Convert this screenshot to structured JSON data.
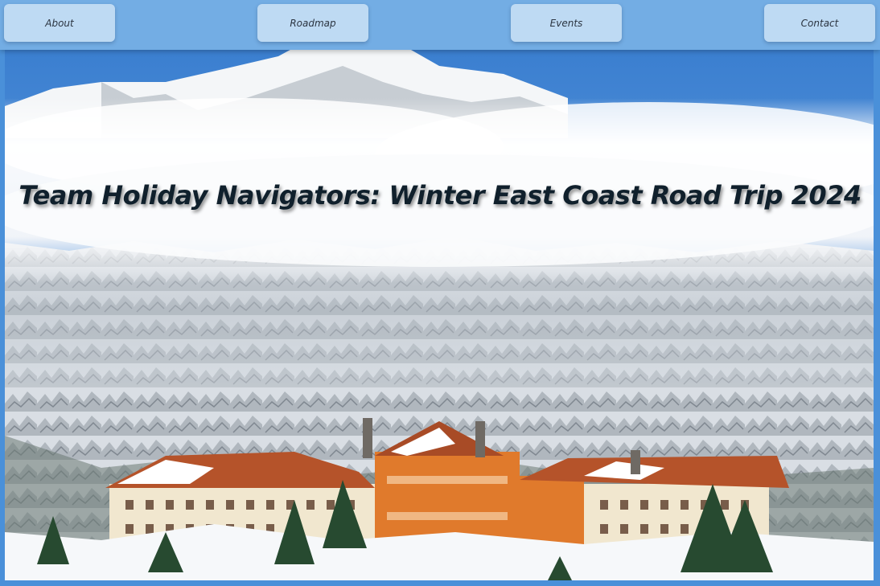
{
  "nav": {
    "items": [
      {
        "label": "About"
      },
      {
        "label": "Roadmap"
      },
      {
        "label": "Events"
      },
      {
        "label": "Contact"
      }
    ]
  },
  "hero": {
    "title": "Team Holiday Navigators: Winter East Coast Road Trip 2024"
  },
  "colors": {
    "background": "#4a90d9",
    "nav_bar": "#96c4ec",
    "nav_button": "#cee4f7",
    "title_text": "#10202c"
  }
}
